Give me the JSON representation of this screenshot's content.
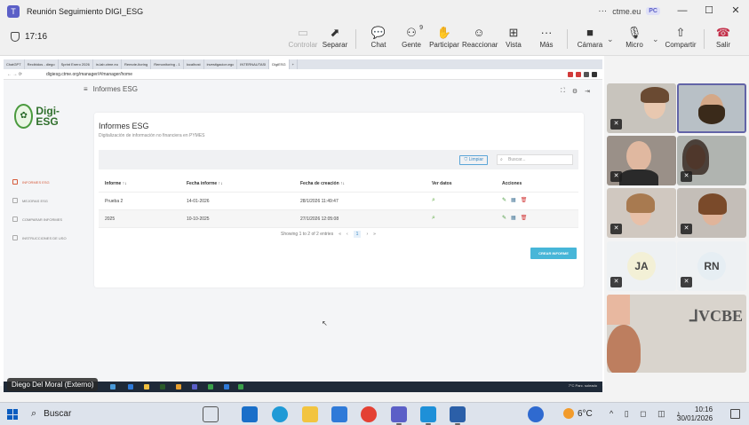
{
  "window": {
    "title": "Reunión Seguimiento DIGI_ESG",
    "org": "ctme.eu",
    "account_badge": "PC",
    "more": "···",
    "minimize": "—",
    "maximize": "☐",
    "close": "✕"
  },
  "meeting": {
    "elapsed": "17:16",
    "toolbar": [
      {
        "label": "Controlar",
        "icon": "▭",
        "disabled": true
      },
      {
        "label": "Separar",
        "icon": "⬈"
      },
      {
        "label": "Chat",
        "icon": "💬"
      },
      {
        "label": "Gente",
        "icon": "⚇",
        "badge": "9"
      },
      {
        "label": "Participar",
        "icon": "✋"
      },
      {
        "label": "Reaccionar",
        "icon": "☺"
      },
      {
        "label": "Vista",
        "icon": "⊞"
      },
      {
        "label": "Más",
        "icon": "···"
      },
      {
        "label": "Cámara",
        "icon": "■"
      },
      {
        "label": "Micro",
        "icon": "🎙"
      },
      {
        "label": "Compartir",
        "icon": "⇧"
      },
      {
        "label": "Salir",
        "icon": "☎"
      }
    ],
    "presenter_label": "Diego Del Moral (Externo)"
  },
  "browser": {
    "tabs": [
      "ChatGPT",
      "Recibidos - diego",
      "Sprint Enero 2026",
      "in-lab.ctme.eu",
      "Remote-ltoring",
      "Remonitoring - 1",
      "localhost",
      "investigacion.egc",
      "INTERNAUTASI",
      "DigiESG"
    ],
    "active_tab": 9,
    "new_tab": "+",
    "url": "digiesg.ctme.org/manager/#/manager/home"
  },
  "app": {
    "logo_text": "Digi-ESG",
    "header_title": "Informes ESG",
    "sidebar": [
      {
        "label": "INFORMES ESG",
        "active": true
      },
      {
        "label": "MEJORAS ESG",
        "active": false
      },
      {
        "label": "COMPARAR INFORMES",
        "active": false
      },
      {
        "label": "INSTRUCCIONES DE USO",
        "active": false
      }
    ],
    "page_title": "Informes ESG",
    "page_subtitle": "Digitalización de información no financiera en PYMES",
    "limpiar_label": "Limpiar",
    "search_placeholder": "Buscar...",
    "table": {
      "headers": [
        "Informe ↑↓",
        "Fecha informe ↑↓",
        "Fecha de creación ↑↓",
        "Ver datos",
        "Acciones"
      ],
      "rows": [
        {
          "informe": "Prueba 2",
          "fecha_informe": "14-01-2026",
          "fecha_creacion": "28/1/2026 11:49:47"
        },
        {
          "informe": "2025",
          "fecha_informe": "10-10-2025",
          "fecha_creacion": "27/1/2026 12:05:08"
        }
      ]
    },
    "pagination_text": "Showing 1 to 2 of 2 entries",
    "pagination_first": "«",
    "pagination_prev": "‹",
    "pagination_page": "1",
    "pagination_next": "›",
    "pagination_last": "»",
    "create_button": "CREAR INFORME"
  },
  "shared_taskbar": {
    "tray_text": "7°C Parc. soleado"
  },
  "participants": [
    {
      "initials": "JA",
      "color": "#f3f0d6"
    },
    {
      "initials": "RN",
      "color": "#e6eef3"
    }
  ],
  "taskbar": {
    "search_label": "Buscar",
    "weather": "6°C",
    "time": "10:16",
    "date": "30/01/2026"
  }
}
